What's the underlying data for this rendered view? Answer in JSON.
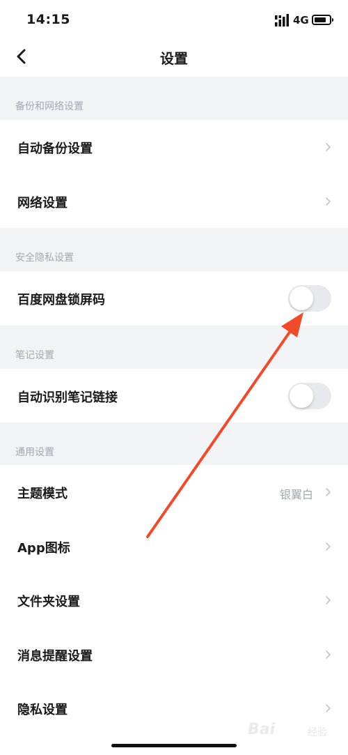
{
  "status_bar": {
    "time": "14:15",
    "network": "4G"
  },
  "header": {
    "title": "设置"
  },
  "sections": {
    "backup": {
      "title": "备份和网络设置",
      "items": [
        {
          "label": "自动备份设置"
        },
        {
          "label": "网络设置"
        }
      ]
    },
    "security": {
      "title": "安全隐私设置",
      "items": [
        {
          "label": "百度网盘锁屏码",
          "toggle": false
        }
      ]
    },
    "notes": {
      "title": "笔记设置",
      "items": [
        {
          "label": "自动识别笔记链接",
          "toggle": false
        }
      ]
    },
    "general": {
      "title": "通用设置",
      "items": [
        {
          "label": "主题模式",
          "value": "银翼白"
        },
        {
          "label": "App图标"
        },
        {
          "label": "文件夹设置"
        },
        {
          "label": "消息提醒设置"
        },
        {
          "label": "隐私设置"
        }
      ]
    }
  },
  "watermark": {
    "brand": "Bai",
    "sub": "经验"
  },
  "colors": {
    "annotation_arrow": "#f04a2a",
    "section_bg": "#f2f3f5",
    "muted_text": "#a3a7b0"
  },
  "icons": [
    "back-chevron-icon",
    "chevron-right-icon",
    "signal-icon",
    "battery-icon"
  ]
}
